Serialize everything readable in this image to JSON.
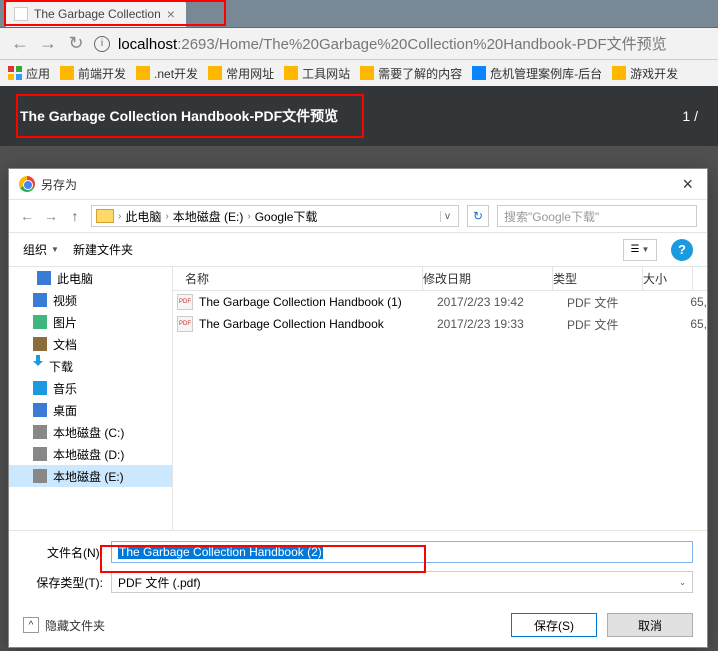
{
  "browser": {
    "tab_title": "The Garbage Collection",
    "url_host": "localhost",
    "url_port": ":2693",
    "url_path": "/Home/The%20Garbage%20Collection%20Handbook-PDF文件预览"
  },
  "bookmarks": {
    "apps": "应用",
    "items": [
      "前端开发",
      ".net开发",
      "常用网址",
      "工具网站",
      "需要了解的内容",
      "危机管理案例库-后台",
      "游戏开发"
    ]
  },
  "pdf": {
    "title": "The Garbage Collection Handbook-PDF文件预览",
    "page": "1 /"
  },
  "dialog": {
    "title": "另存为",
    "path_crumbs": [
      "此电脑",
      "本地磁盘 (E:)",
      "Google下载"
    ],
    "search_placeholder": "搜索\"Google下载\"",
    "organize": "组织",
    "new_folder": "新建文件夹",
    "columns": {
      "name": "名称",
      "date": "修改日期",
      "type": "类型",
      "size": "大小"
    },
    "sidebar": {
      "this_pc": "此电脑",
      "video": "视频",
      "pictures": "图片",
      "documents": "文档",
      "downloads": "下载",
      "music": "音乐",
      "desktop": "桌面",
      "drive_c": "本地磁盘 (C:)",
      "drive_d": "本地磁盘 (D:)",
      "drive_e": "本地磁盘 (E:)"
    },
    "files": [
      {
        "name": "The Garbage Collection Handbook (1)",
        "date": "2017/2/23 19:42",
        "type": "PDF 文件",
        "size": "65,"
      },
      {
        "name": "The Garbage Collection Handbook",
        "date": "2017/2/23 19:33",
        "type": "PDF 文件",
        "size": "65,"
      }
    ],
    "filename_label": "文件名(N):",
    "filename_value": "The Garbage Collection Handbook (2)",
    "filetype_label": "保存类型(T):",
    "filetype_value": "PDF 文件 (.pdf)",
    "hide_folders": "隐藏文件夹",
    "save": "保存(S)",
    "cancel": "取消"
  }
}
